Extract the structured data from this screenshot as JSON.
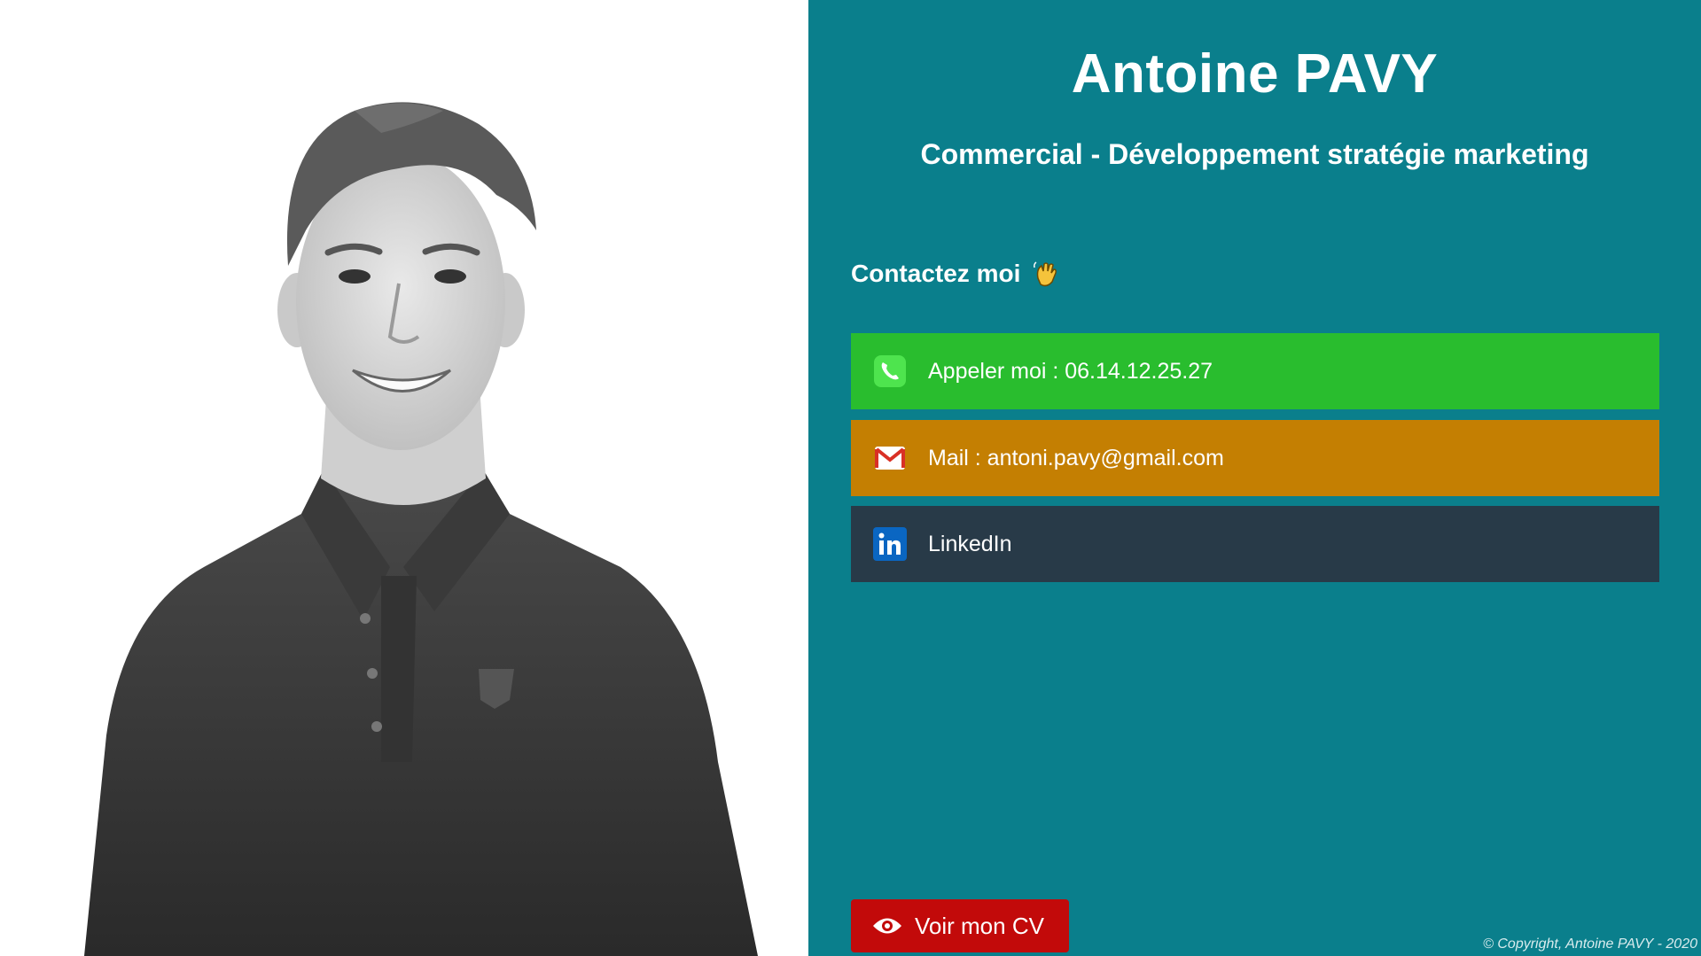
{
  "profile": {
    "name": "Antoine PAVY",
    "title": "Commercial - Développement stratégie marketing"
  },
  "contact": {
    "heading": "Contactez moi",
    "heading_icon": "waving-hand-icon",
    "buttons": [
      {
        "label": "Appeler moi : 06.14.12.25.27",
        "icon": "phone-icon",
        "color": "#29bd2e"
      },
      {
        "label": "Mail : antoni.pavy@gmail.com",
        "icon": "gmail-icon",
        "color": "#c47f02"
      },
      {
        "label": "LinkedIn",
        "icon": "linkedin-icon",
        "color": "#283a48"
      }
    ]
  },
  "cv_button": {
    "label": "Voir mon CV",
    "icon": "eye-icon",
    "color": "#c20a0a"
  },
  "footer": {
    "copyright": "© Copyright, Antoine PAVY - 2020"
  },
  "colors": {
    "panel_background": "#0a7f8c",
    "photo_background": "#ffffff"
  }
}
